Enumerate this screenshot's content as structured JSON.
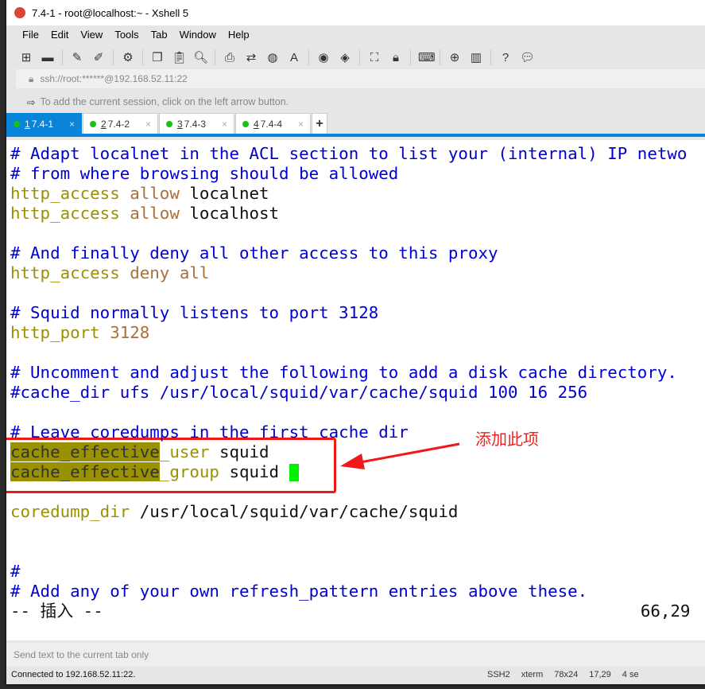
{
  "window": {
    "title": "7.4-1 - root@localhost:~ - Xshell 5"
  },
  "menu": [
    "File",
    "Edit",
    "View",
    "Tools",
    "Tab",
    "Window",
    "Help"
  ],
  "toolbar_icons": [
    "new-session-icon",
    "open-folder-icon",
    "connect-icon",
    "disconnect-icon",
    "properties-icon",
    "copy-icon",
    "paste-icon",
    "find-icon",
    "print-icon",
    "transfer-icon",
    "globe-icon",
    "font-icon",
    "xshell-icon",
    "xftp-icon",
    "fullscreen-icon",
    "lock-icon",
    "keyboard-icon",
    "new-tab-group-icon",
    "layout-icon",
    "help-icon",
    "chat-icon"
  ],
  "address": "ssh://root:******@192.168.52.11:22",
  "hint": "To add the current session, click on the left arrow button.",
  "tabs": [
    {
      "num": "1",
      "label": "7.4-1",
      "active": true
    },
    {
      "num": "2",
      "label": "7.4-2"
    },
    {
      "num": "3",
      "label": "7.4-3"
    },
    {
      "num": "4",
      "label": "7.4-4"
    }
  ],
  "add_tab": "+",
  "terminal": {
    "lines": [
      [
        [
          "c",
          "# Adapt localnet in the ACL section to list your (internal) IP netwo"
        ]
      ],
      [
        [
          "c",
          "# from where browsing should be allowed"
        ]
      ],
      [
        [
          "k",
          "http_access "
        ],
        [
          "v",
          "allow "
        ],
        [
          "t",
          "localnet"
        ]
      ],
      [
        [
          "k",
          "http_access "
        ],
        [
          "v",
          "allow "
        ],
        [
          "t",
          "localhost"
        ]
      ],
      [],
      [
        [
          "c",
          "# And finally deny all other access to this proxy"
        ]
      ],
      [
        [
          "k",
          "http_access "
        ],
        [
          "v",
          "deny all"
        ]
      ],
      [],
      [
        [
          "c",
          "# Squid normally listens to port 3128"
        ]
      ],
      [
        [
          "k",
          "http_port "
        ],
        [
          "v",
          "3128"
        ]
      ],
      [],
      [
        [
          "c",
          "# Uncomment and adjust the following to add a disk cache directory."
        ]
      ],
      [
        [
          "c",
          "#cache_dir ufs /usr/local/squid/var/cache/squid 100 16 256"
        ]
      ],
      [],
      [
        [
          "c",
          "# Leave coredumps in the first cache dir"
        ]
      ],
      [
        [
          "hl",
          "cache_effective"
        ],
        [
          "k",
          "_user "
        ],
        [
          "t",
          "squid"
        ]
      ],
      [
        [
          "hl",
          "cache_effective"
        ],
        [
          "k",
          "_group "
        ],
        [
          "t",
          "squid "
        ],
        [
          "cursor",
          ""
        ]
      ],
      [],
      [
        [
          "k",
          "coredump_dir "
        ],
        [
          "t",
          "/usr/local/squid/var/cache/squid"
        ]
      ],
      [],
      [],
      [
        [
          "c",
          "#"
        ]
      ],
      [
        [
          "c",
          "# Add any of your own refresh_pattern entries above these."
        ]
      ],
      [
        [
          "t",
          "-- 插入 --                                                      66,29"
        ]
      ]
    ],
    "colors": {
      "comment": "#0000d0",
      "keyword": "#9a9000",
      "value": "#a8703a",
      "highlight": "#999100",
      "cursor": "#00f000"
    }
  },
  "annotation": "添加此项",
  "send_placeholder": "Send text to the current tab only",
  "status": {
    "connected": "Connected to 192.168.52.11:22.",
    "protocol": "SSH2",
    "term": "xterm",
    "size": "78x24",
    "pos": "17,29",
    "sessions": "4 se"
  }
}
